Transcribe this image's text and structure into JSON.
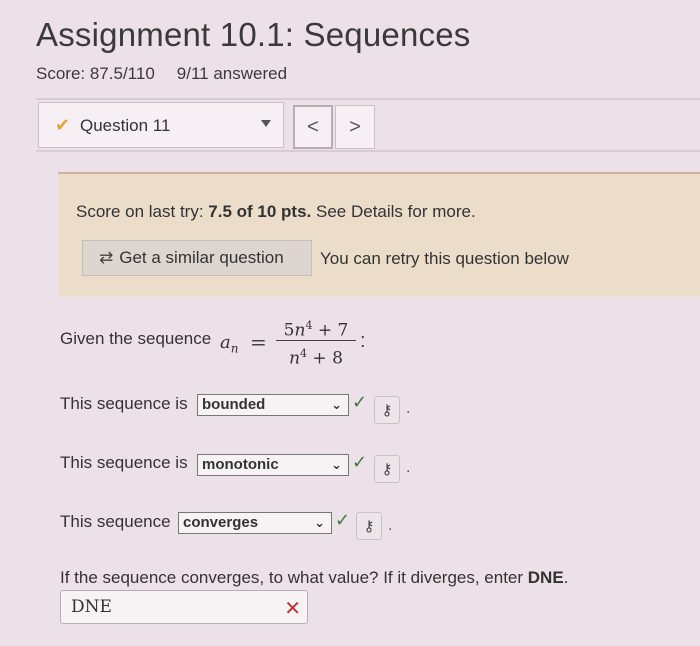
{
  "assignment": {
    "title": "Assignment 10.1: Sequences",
    "score": "Score: 87.5/110",
    "answered": "9/11 answered"
  },
  "question_nav": {
    "selected": "Question 11",
    "status_icon": "check-icon",
    "prev": "<",
    "next": ">"
  },
  "notice": {
    "prefix": "Score on last try: ",
    "score": "7.5 of 10 pts.",
    "suffix": " See Details for more.",
    "similar_button": "Get a similar question",
    "retry_text": "You can retry this question below"
  },
  "problem": {
    "given": "Given the sequence",
    "an_symbol": "a",
    "an_sub": "n",
    "equals": "=",
    "numerator": {
      "coef": "5",
      "var": "n",
      "exp": "4",
      "rest": " + 7"
    },
    "denominator": {
      "var": "n",
      "exp": "4",
      "rest": " + 8"
    },
    "colon": ":"
  },
  "rows": [
    {
      "label": "This sequence is",
      "value": "bounded",
      "status": "correct"
    },
    {
      "label": "This sequence is",
      "value": "monotonic",
      "status": "correct"
    },
    {
      "label": "This sequence",
      "value": "converges",
      "status": "correct"
    }
  ],
  "final": {
    "question_prefix": "If the sequence converges, to what value? If it diverges, enter ",
    "question_bold": "DNE",
    "question_suffix": ".",
    "answer": "DNE",
    "status": "incorrect"
  },
  "colors": {
    "background": "#ede1e9",
    "notice_bg": "#ecdcca",
    "correct": "#3a7a3a",
    "incorrect": "#b33333",
    "partial": "#e3a53a"
  }
}
